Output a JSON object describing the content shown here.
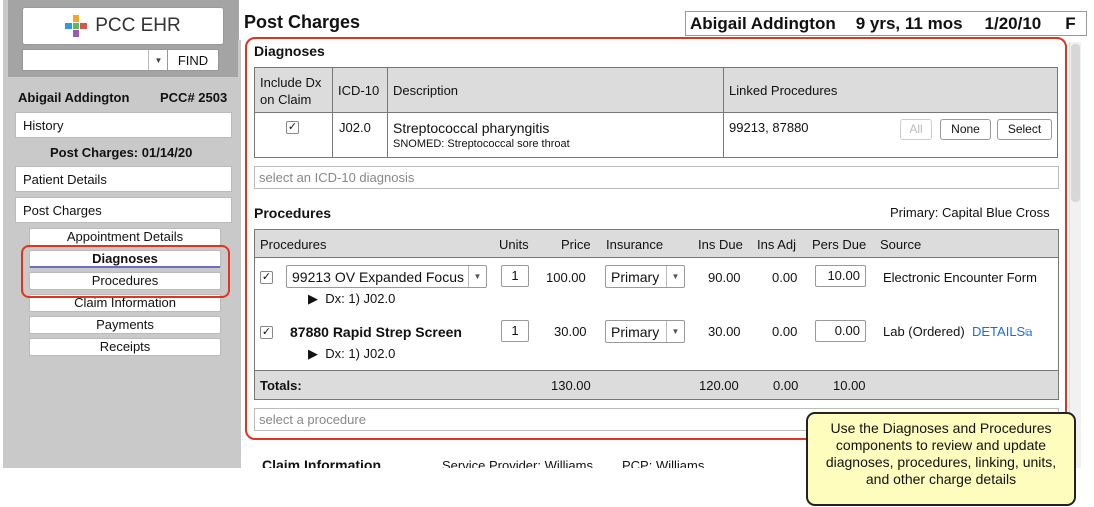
{
  "app": {
    "logo_text": "PCC EHR",
    "find_label": "FIND"
  },
  "sidebar": {
    "patient_name": "Abigail Addington",
    "pcc_number": "PCC# 2503",
    "history_label": "History",
    "post_charges_heading": "Post Charges: 01/14/20",
    "patient_details_label": "Patient Details",
    "post_charges_label": "Post Charges",
    "sub_items": [
      "Appointment Details",
      "Diagnoses",
      "Procedures",
      "Claim Information",
      "Payments",
      "Receipts"
    ]
  },
  "header": {
    "title": "Post Charges",
    "patient_name": "Abigail Addington",
    "age": "9 yrs, 11 mos",
    "dob": "1/20/10",
    "sex": "F"
  },
  "diagnoses": {
    "section_title": "Diagnoses",
    "columns": [
      "Include Dx on Claim",
      "ICD-10",
      "Description",
      "Linked Procedures"
    ],
    "row": {
      "checked": "✓",
      "icd10": "J02.0",
      "description": "Streptococcal pharyngitis",
      "snomed": "SNOMED: Streptococcal sore throat",
      "linked": "99213, 87880"
    },
    "buttons": {
      "all": "All",
      "none": "None",
      "select": "Select"
    },
    "add_placeholder": "select an ICD-10 diagnosis"
  },
  "procedures": {
    "section_title": "Procedures",
    "primary_insurance": "Primary: Capital Blue Cross",
    "columns": [
      "Procedures",
      "Units",
      "Price",
      "Insurance",
      "Ins Due",
      "Ins Adj",
      "Pers Due",
      "Source"
    ],
    "rows": [
      {
        "checked": "✓",
        "procedure": "99213 OV Expanded Focus",
        "dx": "Dx:  1) J02.0",
        "units": "1",
        "price": "100.00",
        "insurance": "Primary",
        "ins_due": "90.00",
        "ins_adj": "0.00",
        "pers_due": "10.00",
        "source": "Electronic Encounter Form",
        "details": ""
      },
      {
        "checked": "✓",
        "procedure": "87880 Rapid Strep Screen",
        "dx": "Dx:  1) J02.0",
        "units": "1",
        "price": "30.00",
        "insurance": "Primary",
        "ins_due": "30.00",
        "ins_adj": "0.00",
        "pers_due": "0.00",
        "source": "Lab (Ordered)",
        "details": "DETAILS"
      }
    ],
    "totals": {
      "label": "Totals:",
      "price": "130.00",
      "ins_due": "120.00",
      "ins_adj": "0.00",
      "pers_due": "10.00"
    },
    "add_placeholder": "select a procedure"
  },
  "claim_info": {
    "title": "Claim Information",
    "service_provider": "Service Provider:  Williams",
    "pcp": "PCP:  Williams"
  },
  "callout": "Use the Diagnoses and Procedures components to review and update diagnoses, procedures, linking, units, and other charge details",
  "colors": {
    "highlight_red": "#e0341f",
    "callout_bg": "#fffdbe",
    "link_blue": "#1a6fd0",
    "sidebar_gray": "#c9c9c9"
  }
}
